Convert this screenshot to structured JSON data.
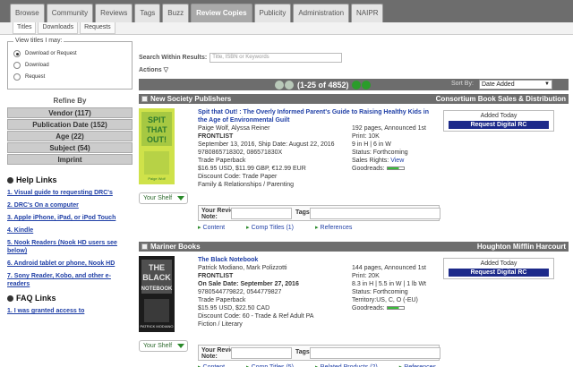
{
  "nav": {
    "tabs": [
      "Browse",
      "Community",
      "Reviews",
      "Tags",
      "Buzz",
      "Review Copies",
      "Publicity",
      "Administration",
      "NAIPR"
    ],
    "active_index": 5
  },
  "subnav": {
    "tabs": [
      "Titles",
      "Downloads",
      "Requests"
    ],
    "active_index": 0
  },
  "sidebar": {
    "view_legend": "View titles I may:",
    "options": [
      "Download or Request",
      "Download",
      "Request"
    ],
    "selected_index": 0,
    "refine_title": "Refine By",
    "refine_items": [
      "Vendor (117)",
      "Publication Date (152)",
      "Age (22)",
      "Subject (54)",
      "Imprint"
    ],
    "help_title": "Help Links",
    "help_links": [
      "1. Visual guide to requesting DRC's",
      "2. DRC's On a computer",
      "3. Apple iPhone, iPad, or iPod Touch",
      "4. Kindle",
      "5. Nook Readers (Nook HD users see below)",
      "6. Android tablet or phone, Nook HD",
      "7. Sony Reader, Kobo, and other e-readers"
    ],
    "faq_title": "FAQ Links",
    "faq_links": [
      "1. I was granted access to"
    ]
  },
  "search": {
    "label": "Search Within Results:",
    "placeholder": "Title, ISBN or Keywords"
  },
  "actions_label": "Actions",
  "pager": {
    "count": "(1-25 of 4852)",
    "sort_label": "Sort By:",
    "sort_value": "Date Added"
  },
  "books": [
    {
      "publisher": "New Society Publishers",
      "distributor": "Consortium Book Sales & Distribution",
      "title": "Spit that Out! : The Overly Informed Parent's Guide to Raising Healthy Kids in the Age of Environmental Guilt",
      "authors": "Paige Wolf, Alyssa Reiner",
      "list": "FRONTLIST",
      "date": "September 13, 2016, Ship Date: August 22, 2016",
      "isbn": "9780865718302, 086571830X",
      "format": "Trade Paperback",
      "price": "$16.95 USD, $11.99 GBP, €12.99 EUR",
      "discount": "Discount Code: Trade Paper",
      "category": "Family & Relationships / Parenting",
      "pages": "192 pages, Announced 1st Print: 10K",
      "size": "9 in H | 6 in W",
      "status": "Status: Forthcoming",
      "rights_label": "Sales Rights:",
      "rights_link": "View",
      "goodreads": "Goodreads:",
      "goodreads_level": 0.7,
      "added": "Added Today",
      "request_btn": "Request Digital RC",
      "shelf": "Your Shelf",
      "review_label": "Your Review:",
      "note_label": "Note:",
      "tags_label": "Tags:",
      "tabs": [
        "Content",
        "Comp Titles (1)",
        "References"
      ],
      "cover": {
        "bg": "#cfe24a",
        "accent": "#2d7a2d",
        "line1": "SPIT",
        "line2": "THAT",
        "line3": "OUT!",
        "author": "Paige Wolf"
      }
    },
    {
      "publisher": "Mariner Books",
      "distributor": "Houghton Mifflin Harcourt",
      "title": "The Black Notebook",
      "authors": "Patrick Modiano, Mark Polizzotti",
      "list": "FRONTLIST",
      "date": "On Sale Date: September 27, 2016",
      "isbn": "9780544779822, 0544779827",
      "format": "Trade Paperback",
      "price": "$15.95 USD, $22.50 CAD",
      "discount": "Discount Code: 60 - Trade & Ref Adult PA",
      "category": "Fiction / Literary",
      "pages": "144 pages, Announced 1st Print: 20K",
      "size": "8.3 in H | 5.5 in W | 1 lb Wt",
      "status": "Status: Forthcoming",
      "rights_label": "Territory:US, C, O (-EU)",
      "rights_link": "",
      "goodreads": "Goodreads:",
      "goodreads_level": 0.7,
      "added": "Added Today",
      "request_btn": "Request Digital RC",
      "shelf": "Your Shelf",
      "review_label": "Your Review:",
      "note_label": "Note:",
      "tags_label": "Tags:",
      "tabs": [
        "Content",
        "Comp Titles (5)",
        "Related Products (2)",
        "References"
      ],
      "cover": {
        "bg": "#1c1c1c",
        "accent": "#e8e8e8",
        "line1": "THE",
        "line2": "BLACK",
        "line3": "NOTEBOOK",
        "author": "PATRICK MODIANO"
      }
    }
  ]
}
